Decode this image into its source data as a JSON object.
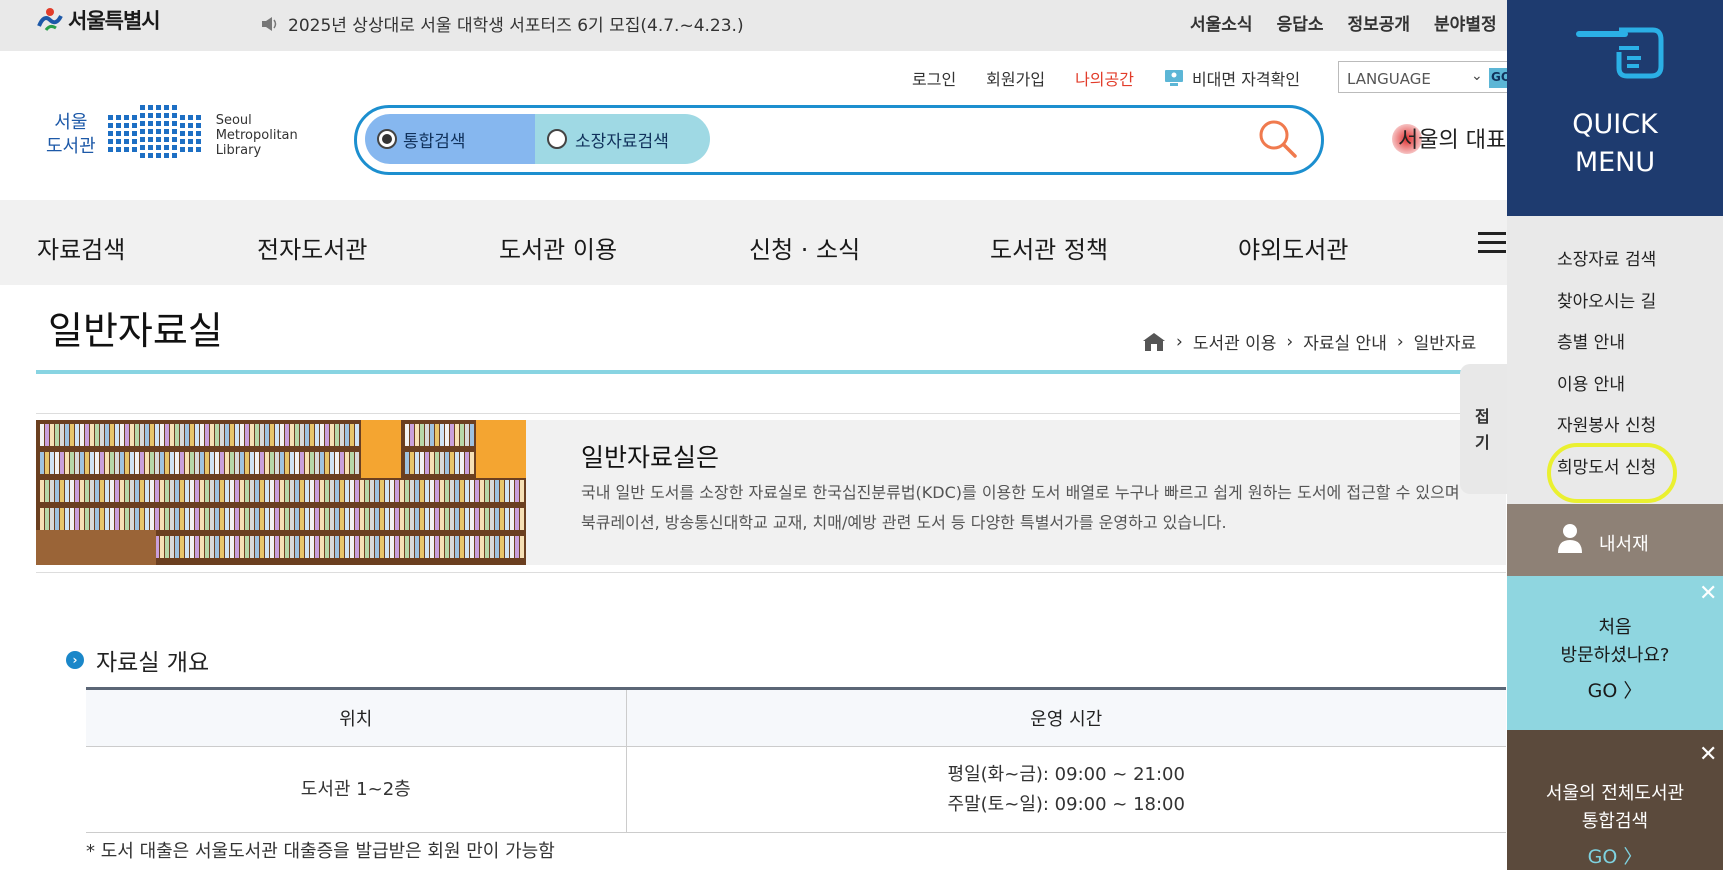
{
  "topbar": {
    "logo_text": "서울특별시",
    "notice": "2025년 상상대로 서울 대학생 서포터즈 6기 모집(4.7.~4.23.)",
    "links": [
      "서울소식",
      "응답소",
      "정보공개",
      "분야별정"
    ]
  },
  "util": {
    "login": "로그인",
    "join": "회원가입",
    "my_space": "나의공간",
    "verify": "비대면 자격확인",
    "language": "LANGUAGE",
    "go": "GO"
  },
  "library_logo": {
    "ko_line1": "서울",
    "ko_line2": "도서관",
    "en_line1": "Seoul",
    "en_line2": "Metropolitan",
    "en_line3": "Library"
  },
  "search": {
    "tab_integrated": "통합검색",
    "tab_collection": "소장자료검색",
    "selected": "통합검색"
  },
  "promo_logo": "서울의 대표도서",
  "gnb": [
    "자료검색",
    "전자도서관",
    "도서관 이용",
    "신청 · 소식",
    "도서관 정책",
    "야외도서관"
  ],
  "page": {
    "title": "일반자료실",
    "breadcrumb": [
      "도서관 이용",
      "자료실 안내",
      "일반자료"
    ]
  },
  "intro": {
    "heading": "일반자료실은",
    "desc_line1": "국내 일반 도서를 소장한 자료실로 한국십진분류법(KDC)를 이용한 도서 배열로 누구나 빠르고 쉽게 원하는 도서에 접근할 수 있으며",
    "desc_line2": "북큐레이션, 방송통신대학교 교재, 치매/예방 관련 도서 등 다양한 특별서가를 운영하고 있습니다."
  },
  "fold_tab": "접기",
  "section": {
    "heading": "자료실 개요",
    "col_location": "위치",
    "col_hours": "운영 시간",
    "location": "도서관 1~2층",
    "hours_weekday": "평일(화~금): 09:00 ~ 21:00",
    "hours_weekend": "주말(토~일): 09:00 ~ 18:00",
    "footnote": "* 도서 대출은 서울도서관 대출증을 발급받은 회원 만이 가능함"
  },
  "quick_menu": {
    "title_line1": "QUICK",
    "title_line2": "MENU",
    "items": [
      "소장자료 검색",
      "찾아오시는 길",
      "층별 안내",
      "이용 안내",
      "자원봉사 신청",
      "희망도서 신청"
    ],
    "highlight_color": "#eaf030",
    "mybook": "내서재",
    "first_q1": "처음",
    "first_q2": "방문하셨나요?",
    "first_go": "GO 〉",
    "allib_q1": "서울의 전체도서관",
    "allib_q2": "통합검색",
    "allib_go": "GO 〉"
  },
  "colors": {
    "accent": "#1c8fcf",
    "quick_head": "#1e3b6f",
    "my_space": "#e23c2a"
  }
}
